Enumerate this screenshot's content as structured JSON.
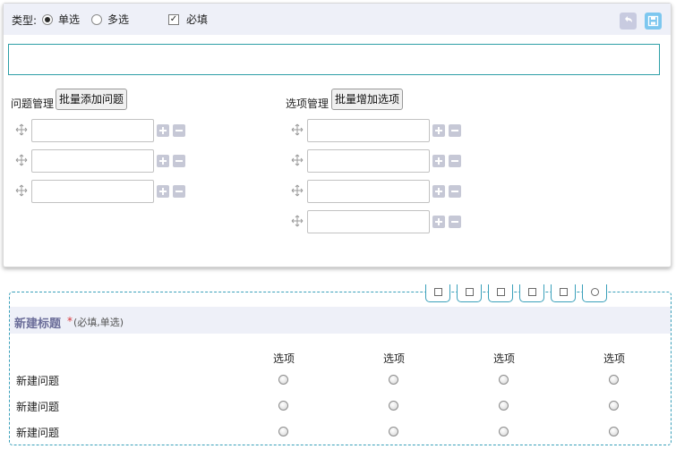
{
  "editor": {
    "type_label": "类型:",
    "options": [
      {
        "label": "单选",
        "selected": true
      },
      {
        "label": "多选",
        "selected": false
      }
    ],
    "required": {
      "label": "必填",
      "checked": true,
      "mark": "✓"
    },
    "toolbar": {
      "undo_icon": "undo-icon",
      "save_icon": "save-icon"
    },
    "title_value": "",
    "question_section": {
      "label": "问题管理",
      "button": "批量添加问题",
      "rows": 3
    },
    "option_section": {
      "label": "选项管理",
      "button": "批量增加选项",
      "rows": 4
    }
  },
  "preview": {
    "title": "新建标题",
    "required_mark": "*",
    "note": "(必填,单选)",
    "column_headers": [
      "选项",
      "选项",
      "选项",
      "选项"
    ],
    "rows": [
      "新建问题",
      "新建问题",
      "新建问题"
    ],
    "tool_icons": [
      "edit-icon",
      "copy-icon",
      "move-down-icon",
      "duplicate-icon",
      "paste-icon",
      "delete-icon"
    ]
  },
  "colors": {
    "accent": "#2e9fa7",
    "header_bg": "#eef0f8",
    "title": "#6b6d99",
    "required": "#d9373a"
  }
}
